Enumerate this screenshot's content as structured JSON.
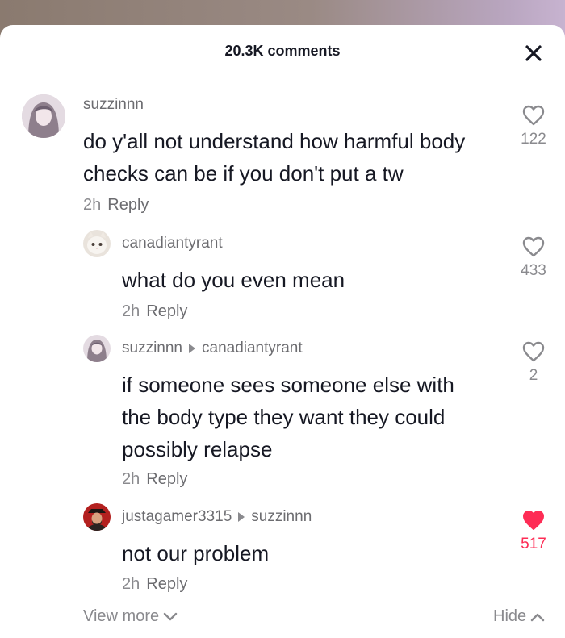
{
  "header": {
    "title": "20.3K comments",
    "close_icon": "close-icon"
  },
  "colors": {
    "liked": "#fe2c55",
    "muted": "#8a8a8e",
    "text": "#161823"
  },
  "comments": [
    {
      "username": "suzzinnn",
      "reply_to": "",
      "text_lines": [
        "do y'all not understand how harmful body",
        "checks can be if you don't put a tw"
      ],
      "time": "2h",
      "reply_label": "Reply",
      "likes": "122",
      "liked": false
    },
    {
      "username": "canadiantyrant",
      "reply_to": "",
      "text_lines": [
        "what do you even mean"
      ],
      "time": "2h",
      "reply_label": "Reply",
      "likes": "433",
      "liked": false
    },
    {
      "username": "suzzinnn",
      "reply_to": "canadiantyrant",
      "text_lines": [
        "if someone sees someone else with",
        "the body type they want they could",
        "possibly relapse"
      ],
      "time": "2h",
      "reply_label": "Reply",
      "likes": "2",
      "liked": false
    },
    {
      "username": "justagamer3315",
      "reply_to": "suzzinnn",
      "text_lines": [
        "not our problem"
      ],
      "time": "2h",
      "reply_label": "Reply",
      "likes": "517",
      "liked": true
    }
  ],
  "footer": {
    "view_more": "View more",
    "hide": "Hide"
  }
}
